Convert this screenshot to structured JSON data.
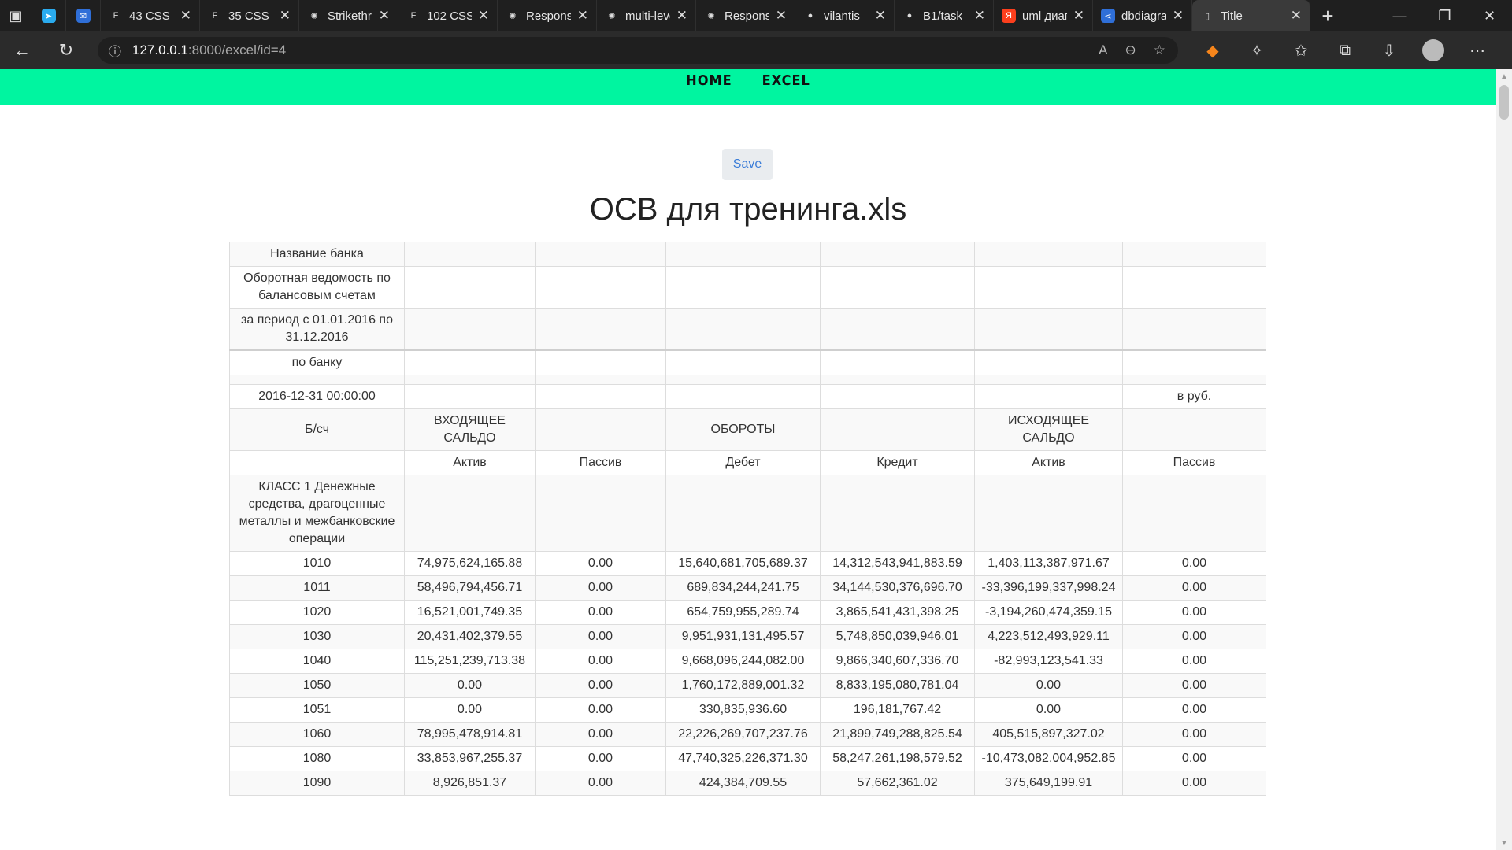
{
  "browser": {
    "tabs": [
      {
        "label": "",
        "icon": "telegram-icon",
        "color": "#2AABEE"
      },
      {
        "label": "",
        "icon": "mail-icon",
        "color": "#2f6fd8"
      },
      {
        "label": "43 CSS",
        "icon": "framer-icon",
        "color": "#555555"
      },
      {
        "label": "35 CSS",
        "icon": "framer-icon",
        "color": "#555555"
      },
      {
        "label": "Strikethrough",
        "icon": "openai-icon",
        "color": "#555555"
      },
      {
        "label": "102 CSS",
        "icon": "framer-icon",
        "color": "#ffffff"
      },
      {
        "label": "Response",
        "icon": "openai-icon",
        "color": "#555555"
      },
      {
        "label": "multi-level",
        "icon": "openai-icon",
        "color": "#555555"
      },
      {
        "label": "Response",
        "icon": "openai-icon",
        "color": "#555555"
      },
      {
        "label": "vilantis",
        "icon": "github-icon",
        "color": "#555555"
      },
      {
        "label": "B1/task",
        "icon": "github-icon",
        "color": "#ffffff"
      },
      {
        "label": "uml диаграмма",
        "icon": "yandex-icon",
        "color": "#fc3f1d"
      },
      {
        "label": "dbdiagram",
        "icon": "share-icon",
        "color": "#2f6fd8"
      },
      {
        "label": "Title",
        "icon": "page-icon",
        "color": "#dddddd"
      }
    ],
    "active_tab": 13,
    "url_host": "127.0.0.1",
    "url_path": ":8000/excel/id=4"
  },
  "nav": {
    "home": "HOME",
    "excel": "EXCEL"
  },
  "save_label": "Save",
  "title": "ОСВ для тренинга.xls",
  "table": {
    "rows": [
      [
        "Название банка",
        "",
        "",
        "",
        "",
        "",
        ""
      ],
      [
        "Оборотная ведомость по балансовым счетам",
        "",
        "",
        "",
        "",
        "",
        ""
      ],
      [
        "за период с 01.01.2016 по 31.12.2016",
        "",
        "",
        "",
        "",
        "",
        ""
      ],
      [
        "по банку",
        "",
        "",
        "",
        "",
        "",
        ""
      ],
      [
        "",
        "",
        "",
        "",
        "",
        "",
        ""
      ],
      [
        "2016-12-31 00:00:00",
        "",
        "",
        "",
        "",
        "",
        "в руб."
      ],
      [
        "Б/сч",
        "ВХОДЯЩЕЕ САЛЬДО",
        "",
        "ОБОРОТЫ",
        "",
        "ИСХОДЯЩЕЕ САЛЬДО",
        ""
      ],
      [
        "",
        "Актив",
        "Пассив",
        "Дебет",
        "Кредит",
        "Актив",
        "Пассив"
      ],
      [
        "КЛАСС 1 Денежные средства, драгоценные металлы и межбанковские операции",
        "",
        "",
        "",
        "",
        "",
        ""
      ],
      [
        "1010",
        "74,975,624,165.88",
        "0.00",
        "15,640,681,705,689.37",
        "14,312,543,941,883.59",
        "1,403,113,387,971.67",
        "0.00"
      ],
      [
        "1011",
        "58,496,794,456.71",
        "0.00",
        "689,834,244,241.75",
        "34,144,530,376,696.70",
        "-33,396,199,337,998.24",
        "0.00"
      ],
      [
        "1020",
        "16,521,001,749.35",
        "0.00",
        "654,759,955,289.74",
        "3,865,541,431,398.25",
        "-3,194,260,474,359.15",
        "0.00"
      ],
      [
        "1030",
        "20,431,402,379.55",
        "0.00",
        "9,951,931,131,495.57",
        "5,748,850,039,946.01",
        "4,223,512,493,929.11",
        "0.00"
      ],
      [
        "1040",
        "115,251,239,713.38",
        "0.00",
        "9,668,096,244,082.00",
        "9,866,340,607,336.70",
        "-82,993,123,541.33",
        "0.00"
      ],
      [
        "1050",
        "0.00",
        "0.00",
        "1,760,172,889,001.32",
        "8,833,195,080,781.04",
        "0.00",
        "0.00"
      ],
      [
        "1051",
        "0.00",
        "0.00",
        "330,835,936.60",
        "196,181,767.42",
        "0.00",
        "0.00"
      ],
      [
        "1060",
        "78,995,478,914.81",
        "0.00",
        "22,226,269,707,237.76",
        "21,899,749,288,825.54",
        "405,515,897,327.02",
        "0.00"
      ],
      [
        "1080",
        "33,853,967,255.37",
        "0.00",
        "47,740,325,226,371.30",
        "58,247,261,198,579.52",
        "-10,473,082,004,952.85",
        "0.00"
      ],
      [
        "1090",
        "8,926,851.37",
        "0.00",
        "424,384,709.55",
        "57,662,361.02",
        "375,649,199.91",
        "0.00"
      ]
    ]
  }
}
